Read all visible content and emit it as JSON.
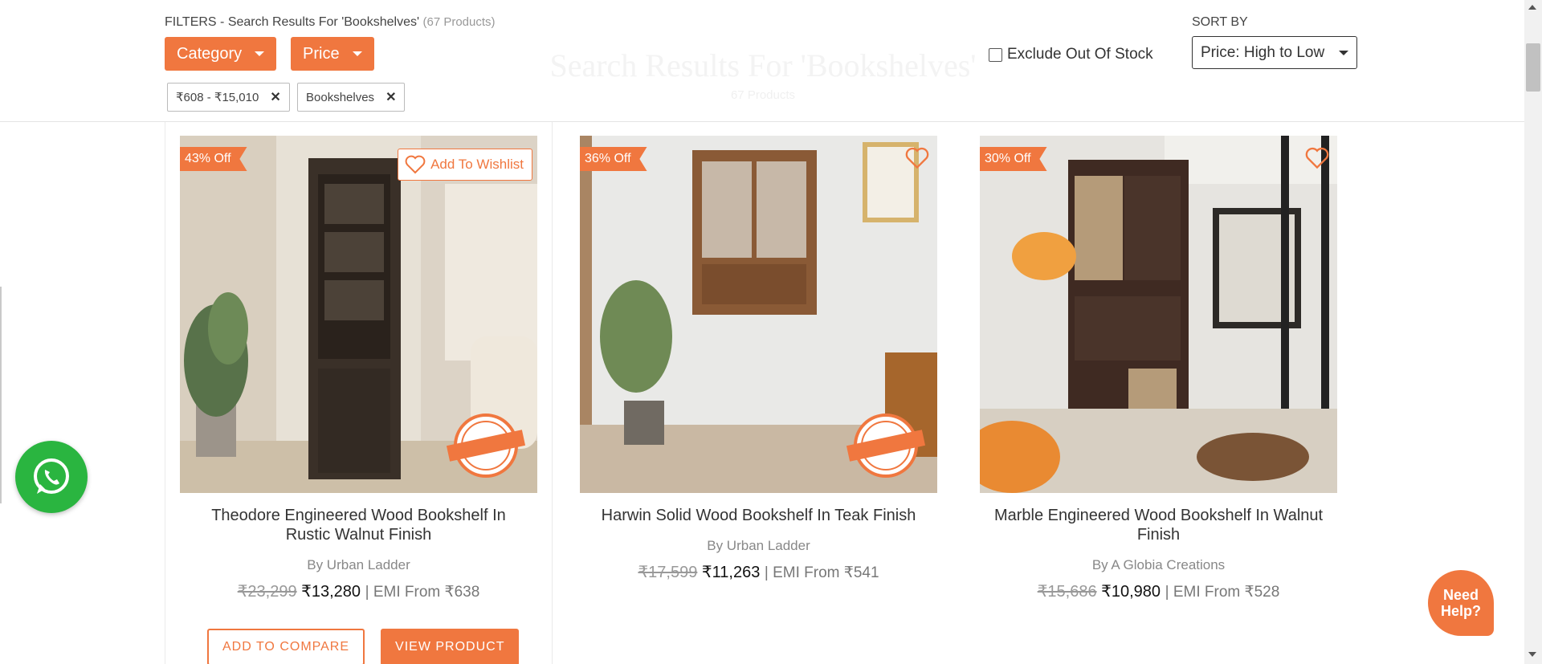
{
  "background": {
    "title": "Search Results For 'Bookshelves'",
    "subtitle": "67 Products"
  },
  "filters": {
    "heading": "FILTERS - Search Results For 'Bookshelves'",
    "count": "(67 Products)",
    "category_label": "Category",
    "price_label": "Price",
    "chips": [
      "₹608 - ₹15,010",
      "Bookshelves"
    ],
    "exclude_label": "Exclude Out Of Stock",
    "exclude_checked": false,
    "sort_label": "SORT BY",
    "sort_value": "Price: High to Low"
  },
  "products": [
    {
      "discount": "43% Off",
      "wishlist_label": "Add To Wishlist",
      "title": "Theodore Engineered Wood Bookshelf In Rustic Walnut Finish",
      "by": "By Urban Ladder",
      "old_price": "₹23,299",
      "price": "₹13,280",
      "emi": "| EMI From ₹638",
      "assured_top": "Urban Ladder",
      "assured_mid": "ASSURED",
      "compare_label": "ADD TO COMPARE",
      "view_label": "VIEW PRODUCT"
    },
    {
      "discount": "36% Off",
      "title": "Harwin Solid Wood Bookshelf In Teak Finish",
      "by": "By Urban Ladder",
      "old_price": "₹17,599",
      "price": "₹11,263",
      "emi": "| EMI From ₹541",
      "assured_top": "Urban Ladder",
      "assured_mid": "ASSURED"
    },
    {
      "discount": "30% Off",
      "title": "Marble Engineered Wood Bookshelf In Walnut Finish",
      "by": "By A Globia Creations",
      "old_price": "₹15,686",
      "price": "₹10,980",
      "emi": "| EMI From ₹528"
    }
  ],
  "help": {
    "label": "Need Help?"
  },
  "colors": {
    "accent": "#f0773f",
    "whatsapp": "#2ab540"
  },
  "icons": [
    "heart-icon",
    "close-icon",
    "caret-down-icon",
    "whatsapp-icon",
    "assured-badge-icon"
  ]
}
